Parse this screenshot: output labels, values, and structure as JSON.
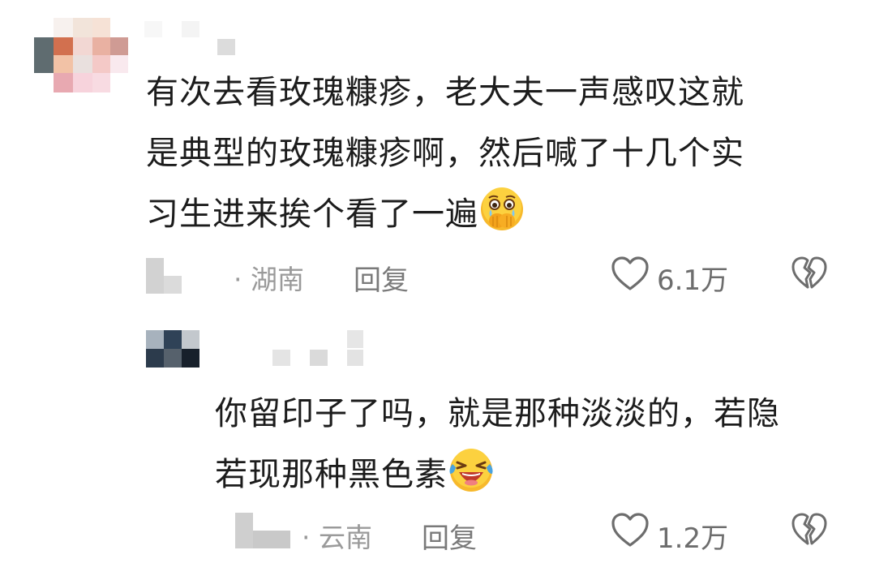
{
  "comments": [
    {
      "text_lines": [
        "有次去看玫瑰糠疹，老大夫一声感叹这就",
        "是典型的玫瑰糠疹啊，然后喊了十几个实",
        "习生进来挨个看了一遍"
      ],
      "emoji": "crying-hand-over-mouth-icon",
      "location": "· 湖南",
      "reply_label": "回复",
      "like_count": "6.1万"
    },
    {
      "text_lines": [
        "你留印子了吗，就是那种淡淡的，若隐",
        "若现那种黑色素"
      ],
      "emoji": "laughing-crying-icon",
      "location": "· 云南",
      "reply_label": "回复",
      "like_count": "1.2万"
    }
  ],
  "colors": {
    "text": "#1c1c1c",
    "meta": "#9a9a9a",
    "icon": "#6d6d6d",
    "emoji_yellow": "#f7b92c"
  }
}
